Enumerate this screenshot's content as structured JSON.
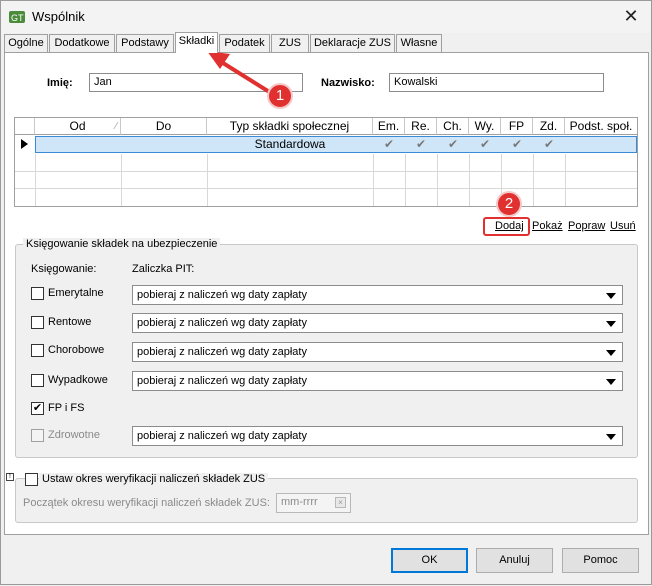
{
  "window": {
    "title": "Wspólnik",
    "close_icon": "close-icon"
  },
  "tabs": [
    "Ogólne",
    "Dodatkowe",
    "Podstawy",
    "Składki",
    "Podatek",
    "ZUS",
    "Deklaracje ZUS",
    "Własne"
  ],
  "active_tab": "Składki",
  "person": {
    "first_name_label": "Imię:",
    "first_name": "Jan",
    "last_name_label": "Nazwisko:",
    "last_name": "Kowalski"
  },
  "grid": {
    "columns": [
      "Od",
      "Do",
      "Typ składki społecznej",
      "Em.",
      "Re.",
      "Ch.",
      "Wy.",
      "FP",
      "Zd.",
      "Podst. społ."
    ],
    "rows": [
      {
        "od": "",
        "do": "",
        "typ": "Standardowa",
        "em": "✔",
        "re": "✔",
        "ch": "✔",
        "wy": "✔",
        "fp": "✔",
        "zd": "✔",
        "podst": ""
      }
    ]
  },
  "links": {
    "add": "Dodaj",
    "show": "Pokaż",
    "edit": "Popraw",
    "delete": "Usuń"
  },
  "booking": {
    "title": "Księgowanie składek na ubezpieczenie",
    "col_booking": "Księgowanie:",
    "col_pit": "Zaliczka PIT:",
    "items": [
      {
        "label": "Emerytalne",
        "checked": false,
        "disabled": false,
        "pit": "pobieraj z naliczeń wg daty zapłaty"
      },
      {
        "label": "Rentowe",
        "checked": false,
        "disabled": false,
        "pit": "pobieraj z naliczeń wg daty zapłaty"
      },
      {
        "label": "Chorobowe",
        "checked": false,
        "disabled": false,
        "pit": "pobieraj z naliczeń wg daty zapłaty"
      },
      {
        "label": "Wypadkowe",
        "checked": false,
        "disabled": false,
        "pit": "pobieraj z naliczeń wg daty zapłaty"
      },
      {
        "label": "FP i FS",
        "checked": true,
        "disabled": false,
        "pit": ""
      },
      {
        "label": "Zdrowotne",
        "checked": false,
        "disabled": true,
        "pit": "pobieraj z naliczeń wg daty zapłaty"
      }
    ]
  },
  "verification": {
    "checkbox_label": "Ustaw okres weryfikacji naliczeń składek ZUS",
    "start_label": "Początek okresu weryfikacji naliczeń składek ZUS:",
    "start_placeholder": "mm-rrrr"
  },
  "buttons": {
    "ok": "OK",
    "cancel": "Anuluj",
    "help": "Pomoc"
  },
  "badges": {
    "first": "1",
    "second": "2"
  },
  "colors": {
    "annotation": "#e03030",
    "selection": "#cfe6f8",
    "focus": "#0078d7"
  }
}
